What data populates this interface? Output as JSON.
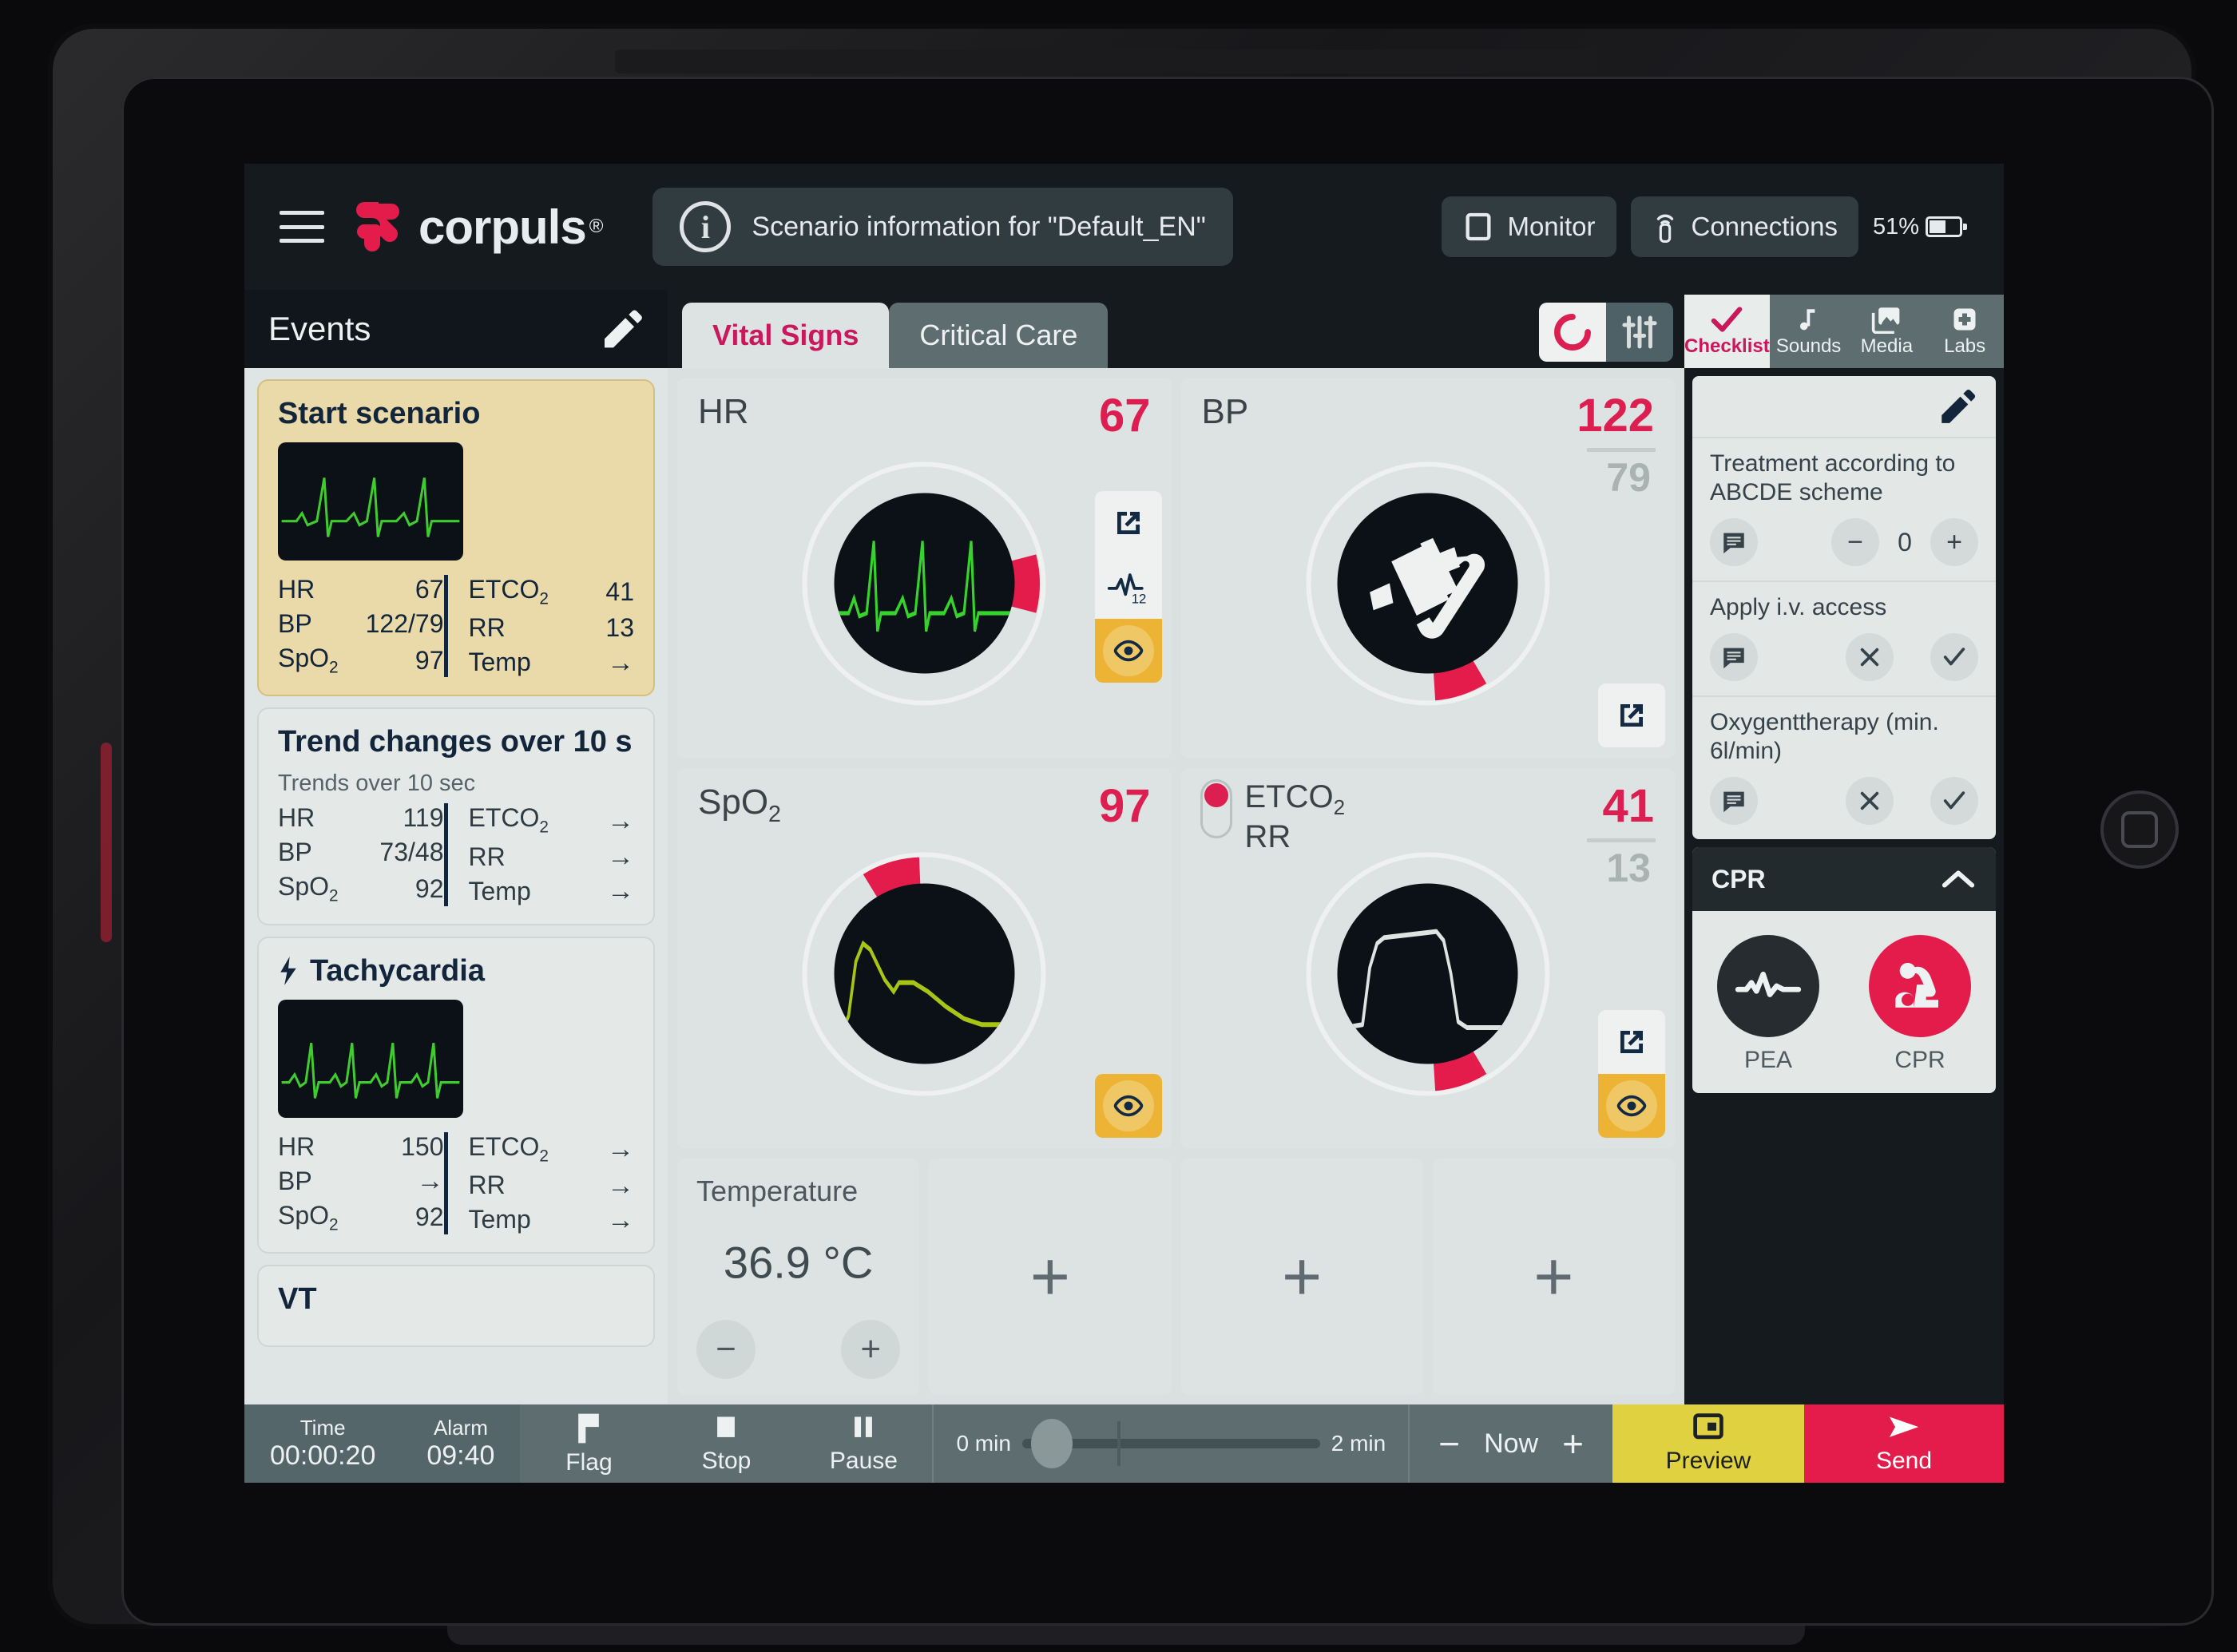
{
  "header": {
    "logo_text": "corpuls",
    "logo_reg": "®",
    "scenario_info": "Scenario information for  \"Default_EN\"",
    "monitor_label": "Monitor",
    "connections_label": "Connections",
    "battery": "51%"
  },
  "events": {
    "title": "Events",
    "cards": [
      {
        "title": "Start scenario",
        "highlight": true,
        "has_ecg": true,
        "ecg_type": "sinus",
        "left": [
          {
            "label": "HR",
            "value": "67"
          },
          {
            "label": "BP",
            "value": "122/79"
          },
          {
            "label": "SpO",
            "sub": "2",
            "value": "97"
          }
        ],
        "right": [
          {
            "label": "ETCO",
            "sub": "2",
            "value": "41"
          },
          {
            "label": "RR",
            "value": "13"
          },
          {
            "label": "Temp",
            "value": "→"
          }
        ]
      },
      {
        "title": "Trend changes over 10 s",
        "subtitle": "Trends over 10 sec",
        "highlight": false,
        "has_ecg": false,
        "left": [
          {
            "label": "HR",
            "value": "119"
          },
          {
            "label": "BP",
            "value": "73/48"
          },
          {
            "label": "SpO",
            "sub": "2",
            "value": "92"
          }
        ],
        "right": [
          {
            "label": "ETCO",
            "sub": "2",
            "value": "→"
          },
          {
            "label": "RR",
            "value": "→"
          },
          {
            "label": "Temp",
            "value": "→"
          }
        ]
      },
      {
        "title": "Tachycardia",
        "highlight": false,
        "has_ecg": true,
        "ecg_type": "tachy",
        "has_bolt": true,
        "left": [
          {
            "label": "HR",
            "value": "150"
          },
          {
            "label": "BP",
            "value": "→"
          },
          {
            "label": "SpO",
            "sub": "2",
            "value": "92"
          }
        ],
        "right": [
          {
            "label": "ETCO",
            "sub": "2",
            "value": "→"
          },
          {
            "label": "RR",
            "value": "→"
          },
          {
            "label": "Temp",
            "value": "→"
          }
        ]
      },
      {
        "title": "VT",
        "highlight": false,
        "has_ecg": false,
        "partial": true,
        "left": [],
        "right": []
      }
    ]
  },
  "main": {
    "tabs": [
      {
        "label": "Vital Signs",
        "active": true
      },
      {
        "label": "Critical Care",
        "active": false
      }
    ],
    "tiles": {
      "hr": {
        "label": "HR",
        "value": "67",
        "waveform": "ecg",
        "gauge_angle": 75,
        "icons": [
          "external-link",
          "ecg-12-lead",
          "eye"
        ],
        "ecg_leads": "12"
      },
      "bp": {
        "label": "BP",
        "value": "122",
        "value2": "79",
        "waveform": "bp-cuff-icon",
        "gauge_angle": 140,
        "icons": [
          "external-link"
        ]
      },
      "spo2": {
        "label": "SpO",
        "sub": "2",
        "value": "97",
        "waveform": "pleth",
        "gauge_angle": 330,
        "icons": [
          "eye"
        ]
      },
      "etco2": {
        "label": "ETCO",
        "sub": "2",
        "label2": "RR",
        "value": "41",
        "value2": "13",
        "waveform": "capno",
        "gauge_angle": 140,
        "icons": [
          "external-link",
          "eye"
        ]
      },
      "temperature": {
        "label": "Temperature",
        "value": "36.9 °C",
        "minus": "−",
        "plus": "+"
      },
      "empty_slots": [
        "+",
        "+",
        "+"
      ]
    }
  },
  "right": {
    "tabs": [
      {
        "label": "Checklist",
        "icon": "check-icon",
        "active": true
      },
      {
        "label": "Sounds",
        "icon": "music-note-icon",
        "active": false
      },
      {
        "label": "Media",
        "icon": "image-icon",
        "active": false
      },
      {
        "label": "Labs",
        "icon": "medical-cross-icon",
        "active": false
      }
    ],
    "checklist": [
      {
        "text": "Treatment according to ABCDE scheme",
        "type": "counter",
        "value": "0",
        "minus": "−",
        "plus": "+"
      },
      {
        "text": "Apply i.v. access",
        "type": "yesno"
      },
      {
        "text": "Oxygenttherapy (min. 6l/min)",
        "type": "yesno"
      }
    ],
    "cpr": {
      "title": "CPR",
      "items": [
        {
          "label": "PEA",
          "icon": "pea-waveform-icon",
          "color": "#262c2f"
        },
        {
          "label": "CPR",
          "icon": "cpr-person-icon",
          "color": "#e31c4c"
        }
      ]
    }
  },
  "bottom": {
    "time_caption": "Time",
    "time_value": "00:00:20",
    "alarm_caption": "Alarm",
    "alarm_value": "09:40",
    "flag_label": "Flag",
    "stop_label": "Stop",
    "pause_label": "Pause",
    "slider_min": "0 min",
    "slider_max": "2 min",
    "minus": "−",
    "now_label": "Now",
    "plus": "+",
    "preview_label": "Preview",
    "send_label": "Send"
  },
  "colors": {
    "brand_red": "#dc1e50",
    "accent_amber": "#edb335",
    "preview_yellow": "#e0d140",
    "dark": "#141a1e",
    "panel": "#dde3e2"
  }
}
